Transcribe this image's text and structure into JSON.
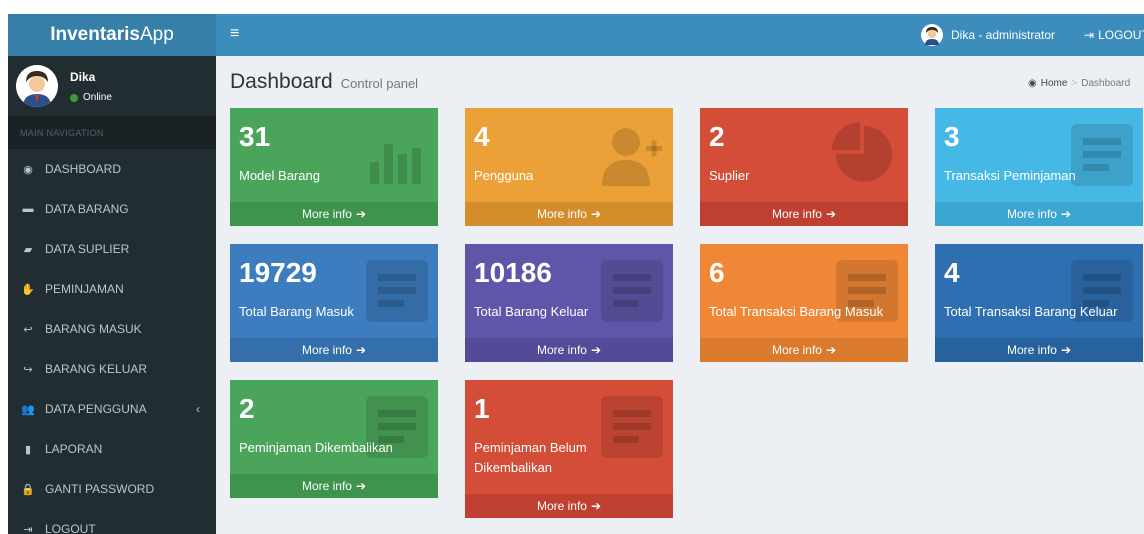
{
  "header": {
    "logo_bold": "Inventaris",
    "logo_rest": "App",
    "toggle_icon": "≡",
    "user_label": "Dika - administrator",
    "logout_label": "LOGOUT"
  },
  "sidebar": {
    "user_name": "Dika",
    "user_status": "Online",
    "nav_header": "MAIN NAVIGATION",
    "items": [
      {
        "label": "DASHBOARD",
        "icon": "dashboard-icon",
        "glyph": "◉"
      },
      {
        "label": "DATA BARANG",
        "icon": "folder-icon",
        "glyph": "▬"
      },
      {
        "label": "DATA SUPLIER",
        "icon": "truck-icon",
        "glyph": "▰"
      },
      {
        "label": "PEMINJAMAN",
        "icon": "hand-icon",
        "glyph": "✋"
      },
      {
        "label": "BARANG MASUK",
        "icon": "reply-icon",
        "glyph": "↩"
      },
      {
        "label": "BARANG KELUAR",
        "icon": "share-icon",
        "glyph": "↪"
      },
      {
        "label": "DATA PENGGUNA",
        "icon": "users-icon",
        "glyph": "👥"
      },
      {
        "label": "LAPORAN",
        "icon": "file-icon",
        "glyph": "▮"
      },
      {
        "label": "GANTI PASSWORD",
        "icon": "lock-icon",
        "glyph": "🔒"
      },
      {
        "label": "LOGOUT",
        "icon": "sign-out-icon",
        "glyph": "⇥"
      }
    ]
  },
  "content": {
    "title": "Dashboard",
    "subtitle": "Control panel",
    "breadcrumb_home": "Home",
    "breadcrumb_sep": ">",
    "breadcrumb_active": "Dashboard"
  },
  "boxes": [
    {
      "value": "31",
      "label": "Model Barang",
      "more": "More info",
      "color": "#4aa55a",
      "icon": "bar-chart-icon"
    },
    {
      "value": "4",
      "label": "Pengguna",
      "more": "More info",
      "color": "#eba138",
      "icon": "user-add-icon"
    },
    {
      "value": "2",
      "label": "Suplier",
      "more": "More info",
      "color": "#d44d38",
      "icon": "pie-chart-icon"
    },
    {
      "value": "3",
      "label": "Transaksi Peminjaman",
      "more": "More info",
      "color": "#46b8e6",
      "icon": "list-icon"
    },
    {
      "value": "19729",
      "label": "Total Barang Masuk",
      "more": "More info",
      "color": "#3c7cbf",
      "icon": "list-icon"
    },
    {
      "value": "10186",
      "label": "Total Barang Keluar",
      "more": "More info",
      "color": "#5f56a9",
      "icon": "list-icon"
    },
    {
      "value": "6",
      "label": "Total Transaksi Barang Masuk",
      "more": "More info",
      "color": "#ef8737",
      "icon": "list-icon"
    },
    {
      "value": "4",
      "label": "Total Transaksi Barang Keluar",
      "more": "More info",
      "color": "#2e6fb1",
      "icon": "list-icon"
    },
    {
      "value": "2",
      "label": "Peminjaman Dikembalikan",
      "more": "More info",
      "color": "#4aa55a",
      "icon": "list-icon"
    },
    {
      "value": "1",
      "label": "Peminjaman Belum Dikembalikan",
      "more": "More info",
      "color": "#d44d38",
      "icon": "list-icon"
    }
  ]
}
